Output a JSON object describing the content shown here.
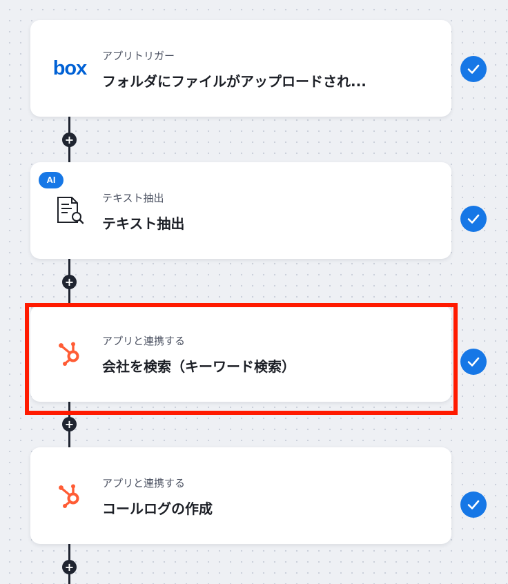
{
  "colors": {
    "background": "#eef0f4",
    "connector": "#1f2430",
    "check_blue": "#1677e6",
    "highlight_red": "#ff1a00",
    "hubspot_orange": "#ff5c35",
    "box_blue": "#0061d5"
  },
  "flow": {
    "add_symbol": "+",
    "steps": [
      {
        "subtitle": "アプリトリガー",
        "title": "フォルダにファイルがアップロードされ...",
        "icon": "box-logo-icon",
        "logo_text": "box",
        "completed": true
      },
      {
        "badge": "AI",
        "subtitle": "テキスト抽出",
        "title": "テキスト抽出",
        "icon": "document-search-icon",
        "completed": true
      },
      {
        "subtitle": "アプリと連携する",
        "title": "会社を検索（キーワード検索）",
        "icon": "hubspot-icon",
        "completed": true,
        "highlighted": true
      },
      {
        "subtitle": "アプリと連携する",
        "title": "コールログの作成",
        "icon": "hubspot-icon",
        "completed": true
      }
    ]
  }
}
